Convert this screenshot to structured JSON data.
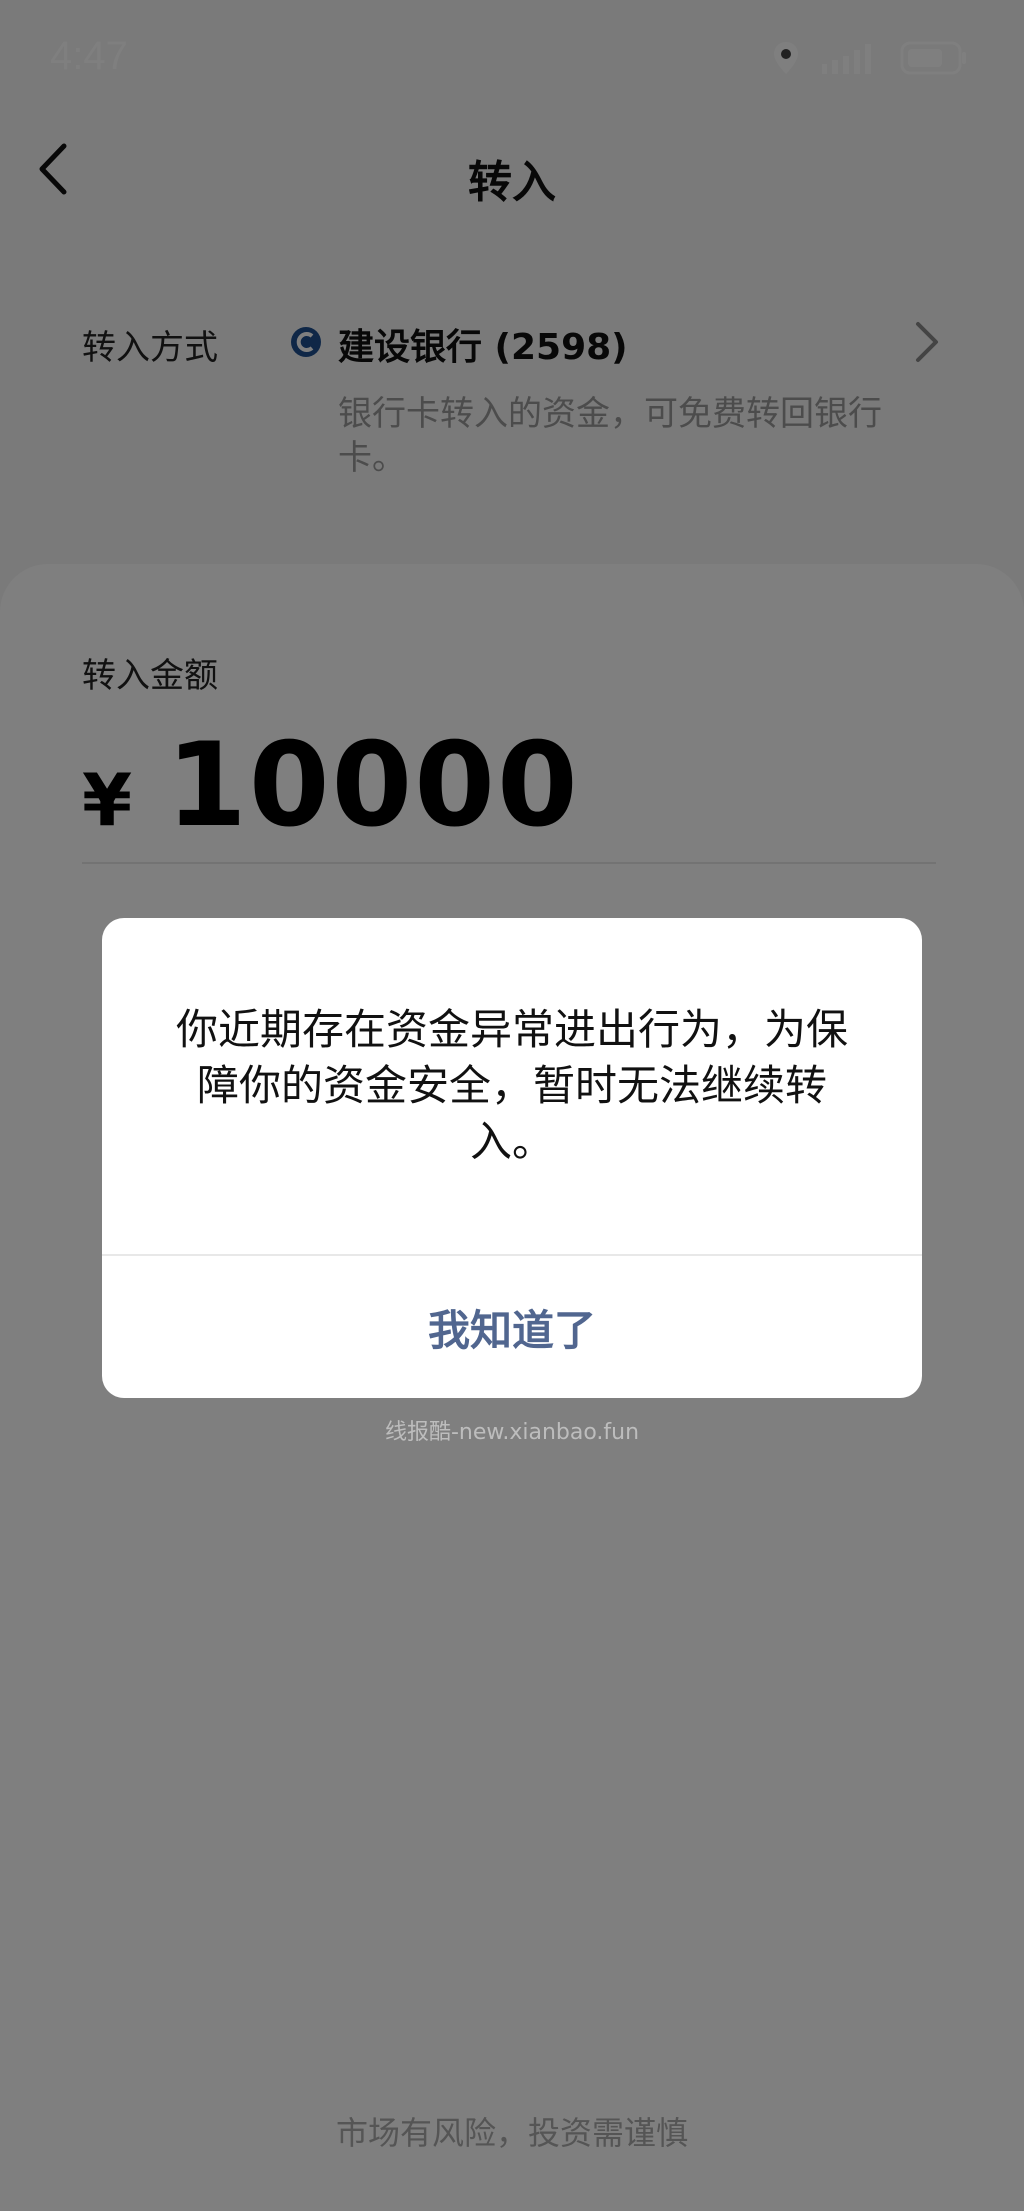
{
  "status_bar": {
    "time": "4:47"
  },
  "nav": {
    "title": "转入"
  },
  "transfer_method": {
    "label": "转入方式",
    "bank_name": "建设银行 (2598)",
    "description": "银行卡转入的资金，可免费转回银行卡。"
  },
  "amount": {
    "label": "转入金额",
    "currency": "¥",
    "value": "10000"
  },
  "dialog": {
    "message": "你近期存在资金异常进出行为，为保障你的资金安全，暂时无法继续转入。",
    "button_label": "我知道了"
  },
  "watermark": "线报酷-new.xianbao.fun",
  "footer": {
    "risk_note": "市场有风险，投资需谨慎"
  },
  "colors": {
    "dialog_button": "#51668f",
    "overlay": "#808080"
  }
}
